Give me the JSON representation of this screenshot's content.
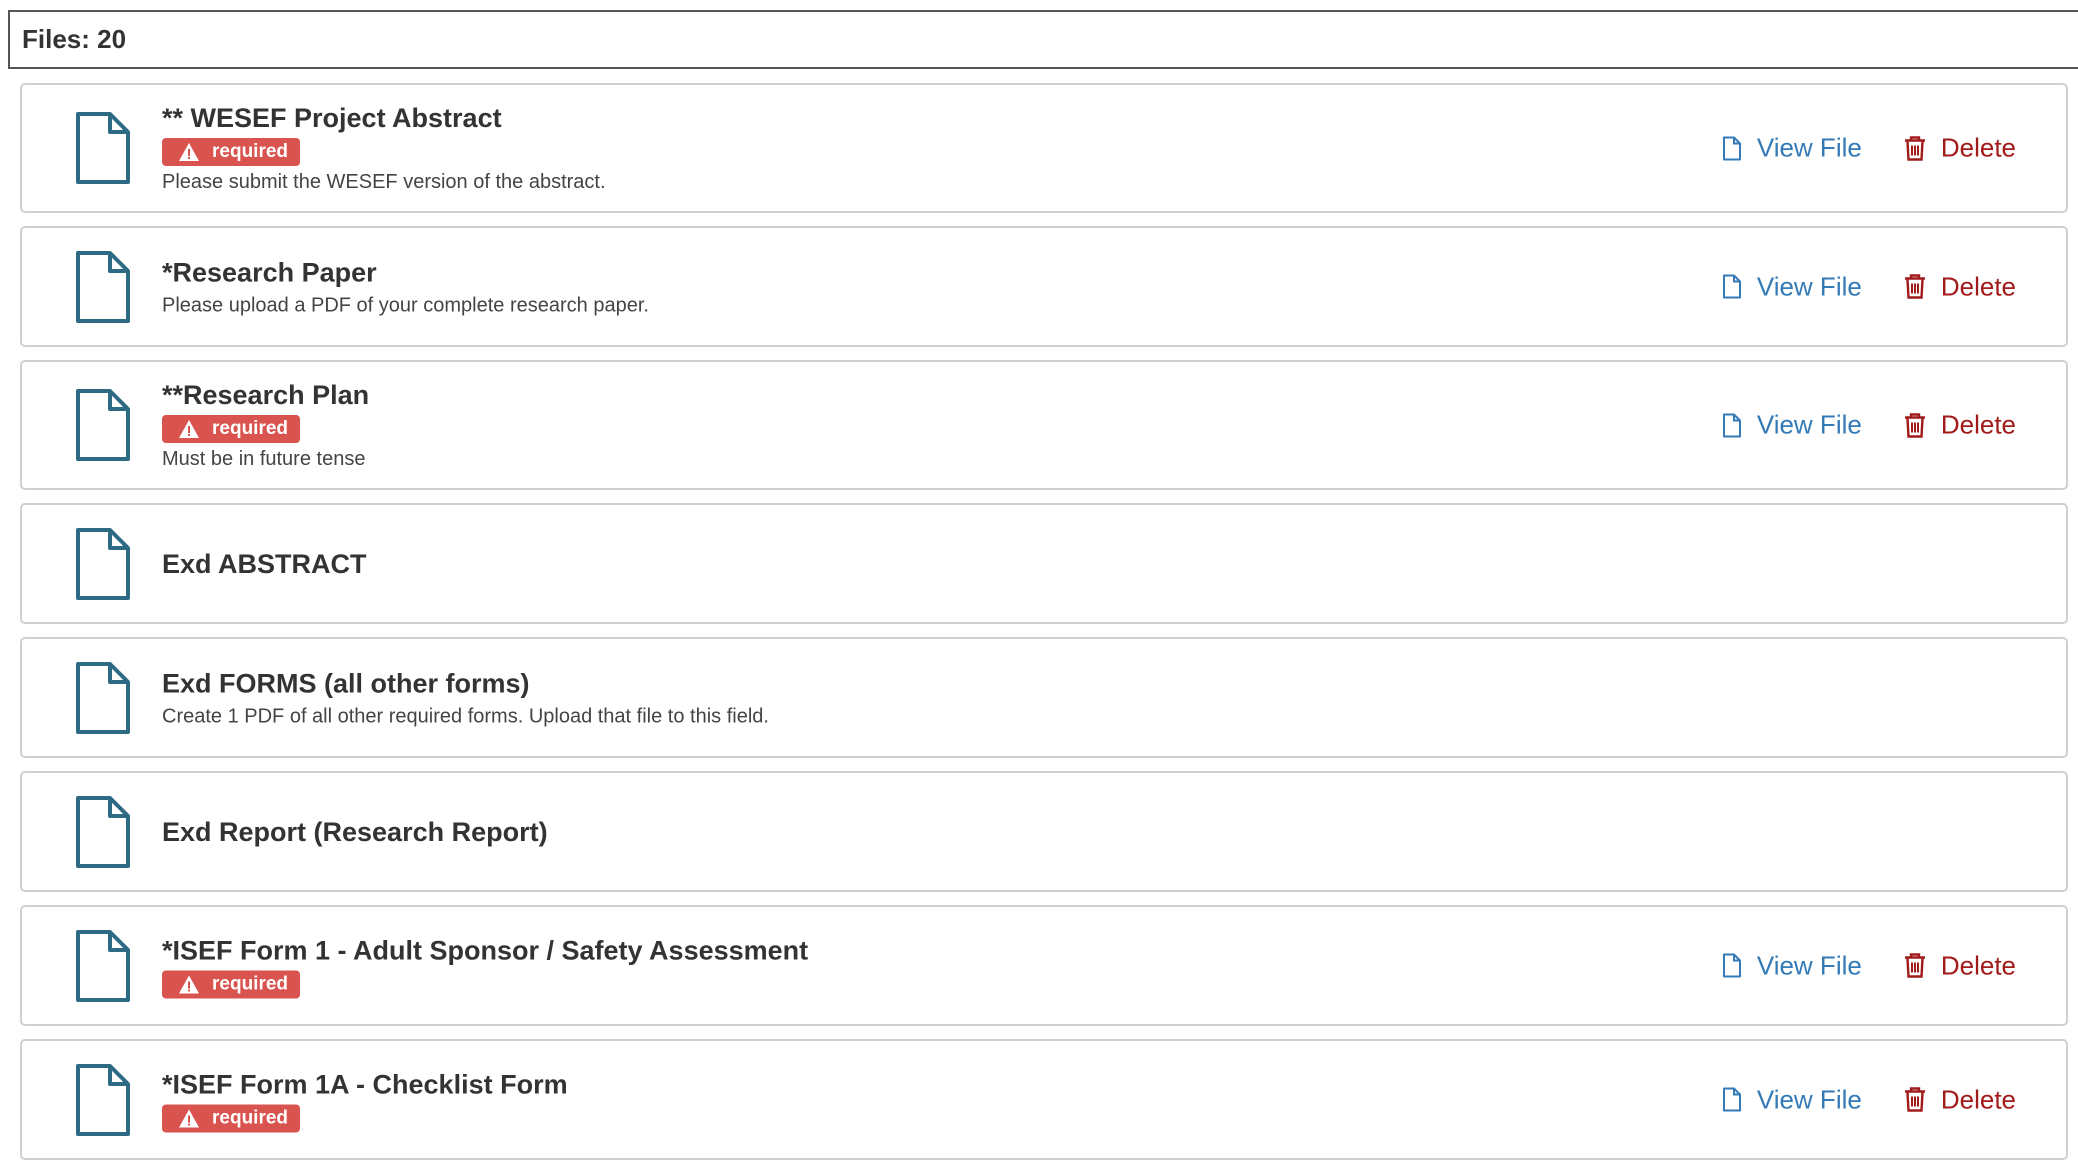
{
  "header": {
    "files_label": "Files: 20"
  },
  "actions": {
    "view_label": "View File",
    "delete_label": "Delete"
  },
  "badge": {
    "required_label": "required"
  },
  "colors": {
    "icon_stroke": "#2f6a85",
    "required_bg": "#d9534f",
    "view_link": "#337ab7",
    "delete_link": "#a21b1b"
  },
  "files": [
    {
      "title": "** WESEF Project Abstract",
      "required": true,
      "description": "Please submit the WESEF version of the abstract.",
      "has_actions": true
    },
    {
      "title": "*Research Paper",
      "required": false,
      "description": "Please upload a PDF of your complete research paper.",
      "has_actions": true
    },
    {
      "title": "**Research Plan",
      "required": true,
      "description": "Must be in future tense",
      "has_actions": true
    },
    {
      "title": "Exd ABSTRACT",
      "required": false,
      "description": "",
      "has_actions": false
    },
    {
      "title": "Exd FORMS (all other forms)",
      "required": false,
      "description": "Create 1 PDF of all other required forms. Upload that file to this field.",
      "has_actions": false
    },
    {
      "title": "Exd Report (Research Report)",
      "required": false,
      "description": "",
      "has_actions": false
    },
    {
      "title": "*ISEF Form 1 - Adult Sponsor / Safety Assessment",
      "required": true,
      "description": "",
      "has_actions": true
    },
    {
      "title": "*ISEF Form 1A - Checklist Form",
      "required": true,
      "description": "",
      "has_actions": true
    }
  ]
}
